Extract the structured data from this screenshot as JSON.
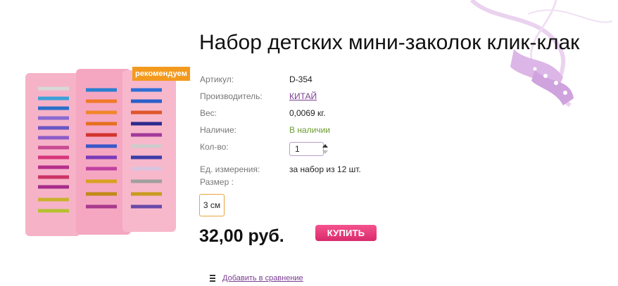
{
  "product": {
    "title": "Набор детских мини-заколок клик-клак",
    "badge": "рекомендуем",
    "image_alt": "product-photo-hair-clips"
  },
  "details": {
    "article_label": "Артикул:",
    "article_value": "D-354",
    "maker_label": "Производитель:",
    "maker_value": "КИТАЙ",
    "weight_label": "Вес:",
    "weight_value": "0,0069 кг.",
    "stock_label": "Наличие:",
    "stock_value": "В наличии",
    "qty_label": "Кол-во:",
    "qty_value": "1",
    "unit_label": "Ед. измерения:",
    "unit_value": "за набор из 12 шт.",
    "size_label": "Размер :",
    "size_option": "3 см"
  },
  "purchase": {
    "price": "32,00 руб.",
    "buy_label": "КУПИТЬ"
  },
  "compare": {
    "label": "Добавить в сравнение"
  },
  "colors": {
    "accent": "#e53a7a",
    "badge": "#f39a1e",
    "link": "#7a3c91",
    "in_stock": "#6b9a2f"
  },
  "icons": [
    "ribbon-decoration-icon",
    "spinner-arrows-icon",
    "compare-list-icon"
  ]
}
